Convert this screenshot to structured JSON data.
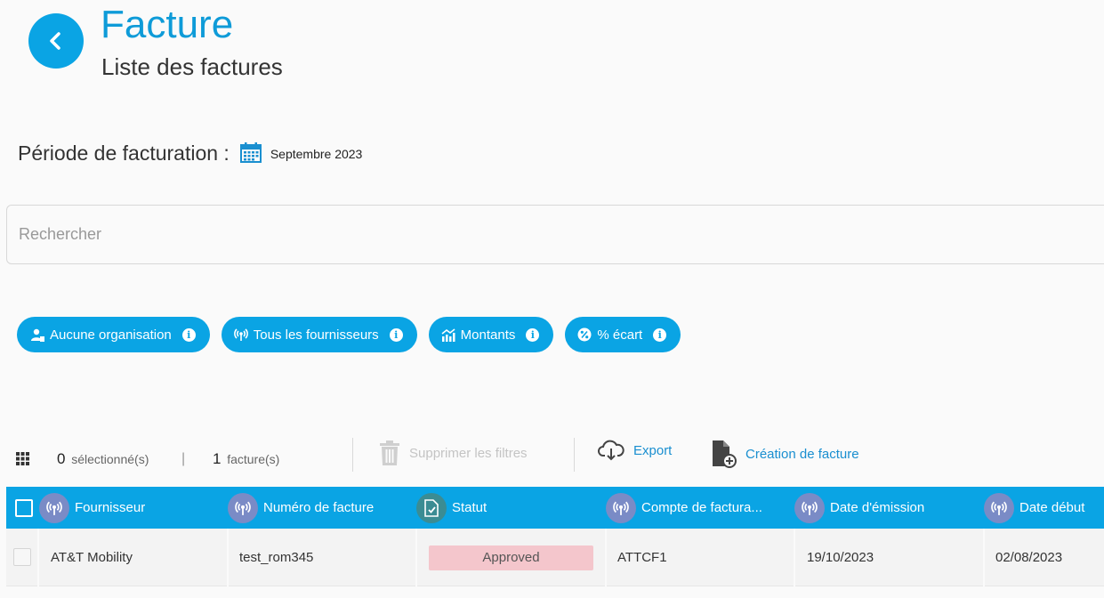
{
  "header": {
    "title": "Facture",
    "subtitle": "Liste des factures"
  },
  "period": {
    "label": "Période de facturation :",
    "value": "Septembre 2023"
  },
  "search": {
    "placeholder": "Rechercher",
    "value": ""
  },
  "filters": [
    {
      "label": "Aucune organisation",
      "icon": "organization-icon"
    },
    {
      "label": "Tous les fournisseurs",
      "icon": "antenna-icon"
    },
    {
      "label": "Montants",
      "icon": "chart-icon"
    },
    {
      "label": "% écart",
      "icon": "percent-icon"
    }
  ],
  "toolbar": {
    "selected_count": "0",
    "selected_label": "sélectionné(s)",
    "separator": "|",
    "invoice_count": "1",
    "invoice_label": "facture(s)",
    "clear_filters_label": "Supprimer les filtres",
    "export_label": "Export",
    "create_label": "Création de facture"
  },
  "table": {
    "columns": [
      {
        "label": "Fournisseur",
        "icon": "antenna-icon"
      },
      {
        "label": "Numéro de facture",
        "icon": "antenna-icon"
      },
      {
        "label": "Statut",
        "icon": "document-check-icon"
      },
      {
        "label": "Compte de factura...",
        "icon": "antenna-icon"
      },
      {
        "label": "Date d'émission",
        "icon": "antenna-icon"
      },
      {
        "label": "Date début",
        "icon": "antenna-icon"
      }
    ],
    "rows": [
      {
        "fournisseur": "AT&T Mobility",
        "numero": "test_rom345",
        "statut": "Approved",
        "compte": "ATTCF1",
        "date_emission": "19/10/2023",
        "date_debut": "02/08/2023"
      }
    ]
  },
  "colors": {
    "accent": "#0aa4e4",
    "title": "#0e9bd8",
    "column_icon": "#7a8bc6",
    "status_icon": "#3b8c93",
    "approved_badge": "#f4c6cc"
  }
}
